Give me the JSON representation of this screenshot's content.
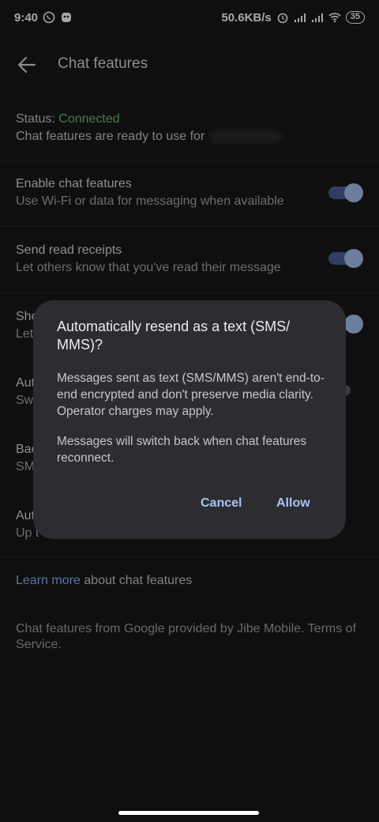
{
  "status_bar": {
    "time": "9:40",
    "network_speed": "50.6KB/s",
    "battery": "35",
    "icons": [
      "whatsapp-icon",
      "app-icon",
      "alarm-icon",
      "signal-icon",
      "signal-icon",
      "wifi-icon",
      "battery-icon"
    ]
  },
  "app_bar": {
    "title": "Chat features",
    "back_icon": "arrow-back-icon"
  },
  "status": {
    "label": "Status:",
    "value": "Connected",
    "description": "Chat features are ready to use for",
    "connected_color": "#6fbf73"
  },
  "settings": [
    {
      "title": "Enable chat features",
      "subtitle": "Use Wi-Fi or data for messaging when available",
      "enabled": true
    },
    {
      "title": "Send read receipts",
      "subtitle": "Let others know that you've read their message",
      "enabled": true
    },
    {
      "title": "Sho",
      "subtitle": "Let",
      "enabled": true
    },
    {
      "title": "Aut",
      "subtitle": "Sw",
      "enabled": false
    },
    {
      "title": "Bac",
      "subtitle": "SM"
    },
    {
      "title": "Aut",
      "subtitle": "Up to"
    }
  ],
  "learn_more": {
    "link": "Learn more",
    "text": " about chat features"
  },
  "footer": "Chat features from Google provided by Jibe Mobile. Terms of Service.",
  "dialog": {
    "title": "Automatically resend as a text (SMS/ MMS)?",
    "body1": "Messages sent as text (SMS/MMS) aren't end-to-end encrypted and don't preserve media clarity. Operator charges may apply.",
    "body2": "Messages will switch back when chat features reconnect.",
    "cancel": "Cancel",
    "allow": "Allow"
  },
  "colors": {
    "background": "#18181a",
    "accent": "#a9c4f5",
    "switch_track": "#4a5f9c",
    "switch_knob": "#a8c0f0",
    "link": "#8ab4f8"
  }
}
